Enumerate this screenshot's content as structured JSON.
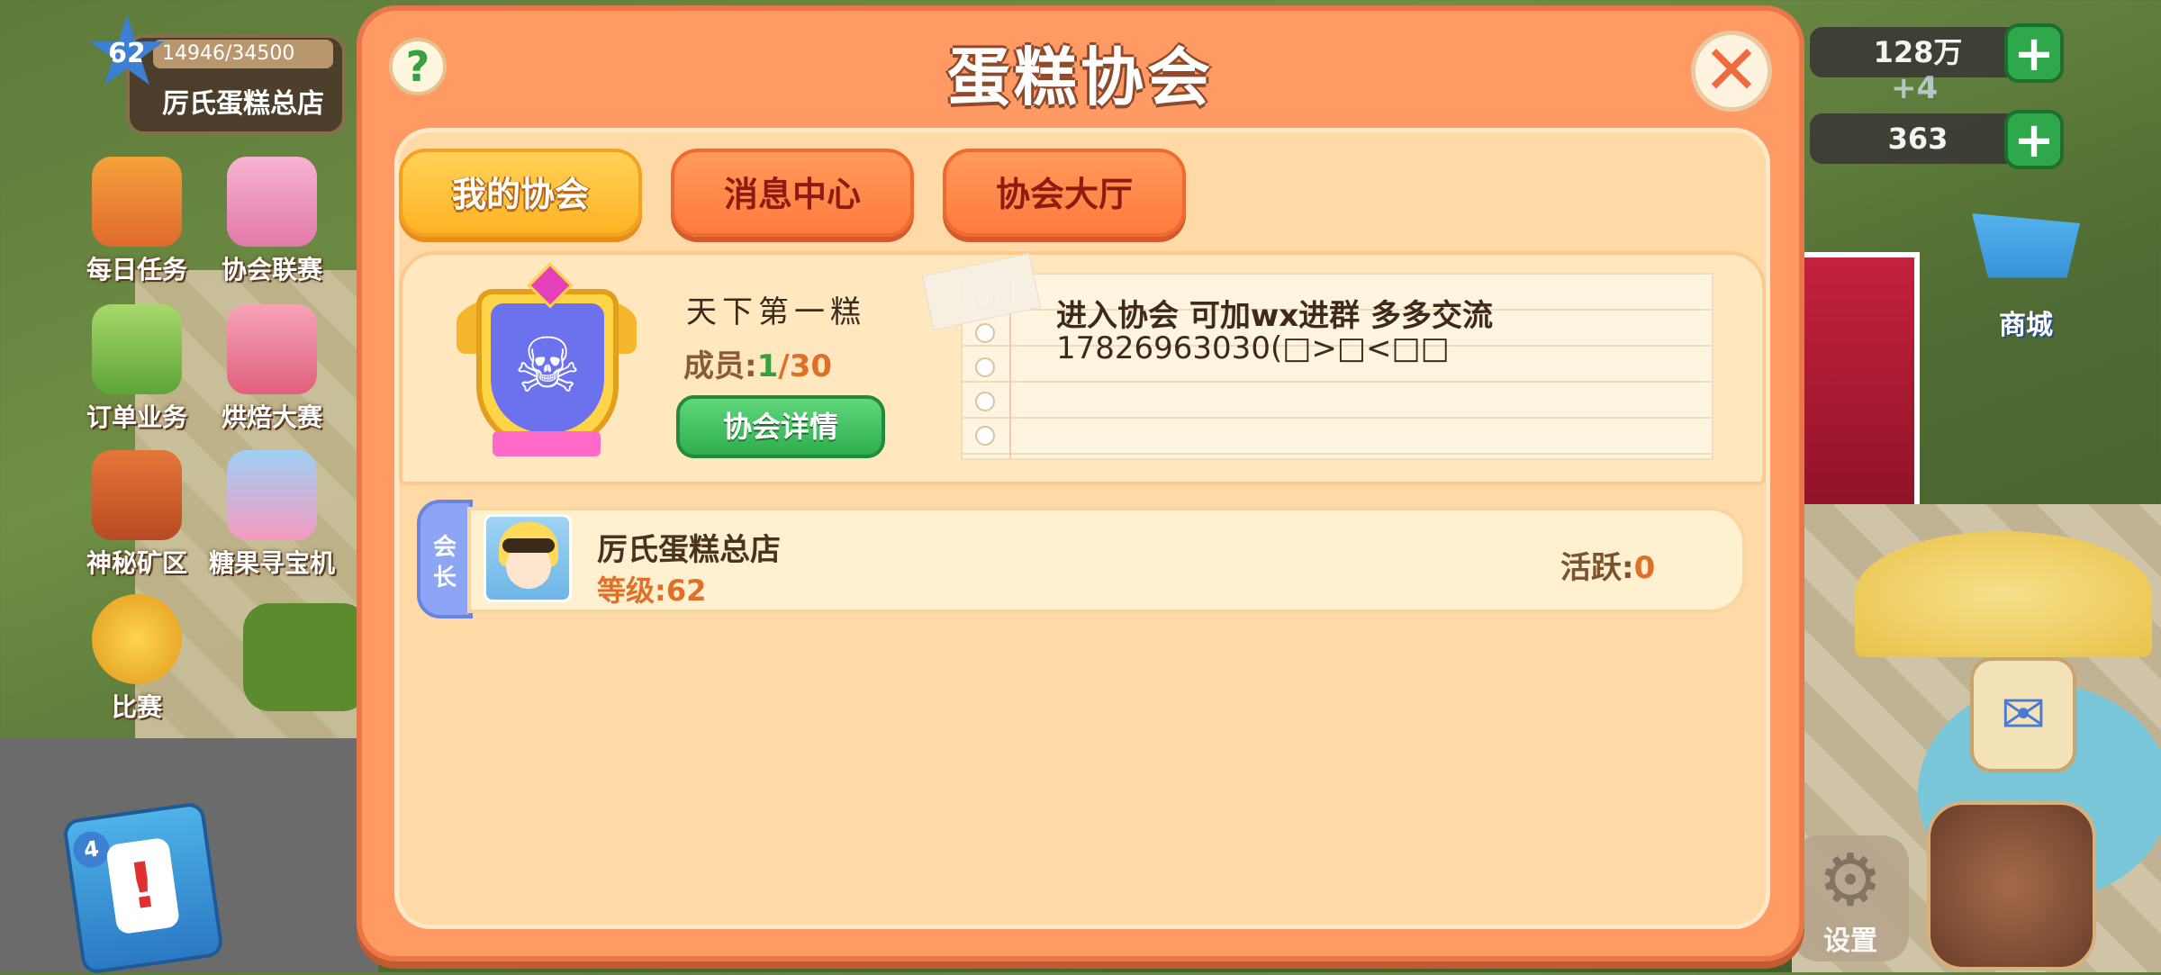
{
  "hud": {
    "level": "62",
    "xp": "14946/34500",
    "store_name": "厉氏蛋糕总店",
    "side_menu": [
      "每日任务",
      "协会联赛",
      "订单业务",
      "烘焙大赛",
      "神秘矿区",
      "糖果寻宝机",
      "比赛"
    ],
    "notebook_badge": "4",
    "currency_coins": "128万",
    "coin_gain": "+4",
    "currency_gems": "363",
    "shop_label": "商城",
    "settings_label": "设置"
  },
  "dialog": {
    "title": "蛋糕协会",
    "tabs": [
      "我的协会",
      "消息中心",
      "协会大厅"
    ],
    "guild": {
      "name": "天下第一糕",
      "members_label": "成员:",
      "members_current": "1",
      "members_max": "/30",
      "detail_button": "协会详情",
      "notice_line1": "进入协会 可加wx进群 多多交流",
      "notice_line2": "17826963030(□>□<□□"
    },
    "members": [
      {
        "rank": "会长",
        "name": "厉氏蛋糕总店",
        "level_label": "等级:",
        "level": "62",
        "activity_label": "活跃:",
        "activity": "0"
      }
    ]
  },
  "colors": {
    "dialog_bg": "#ff9a64",
    "panel_bg": "#ffd9a6",
    "active_tab": "#ffb324",
    "green_button": "#2fae4f",
    "accent_orange": "#e07028"
  }
}
